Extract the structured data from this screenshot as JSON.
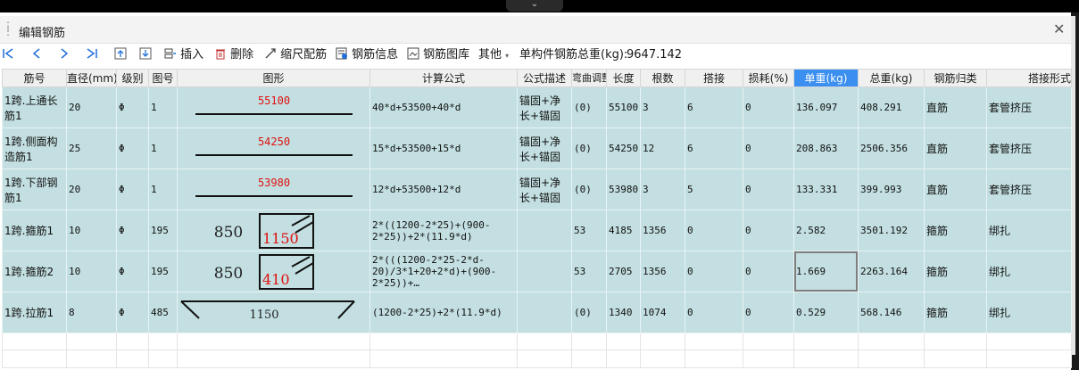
{
  "window": {
    "title": "编辑钢筋"
  },
  "toolbar": {
    "insert": "插入",
    "delete": "删除",
    "scale_rebar": "缩尺配筋",
    "rebar_info": "钢筋信息",
    "rebar_library": "钢筋图库",
    "other": "其他",
    "total_label": "单构件钢筋总重(kg):",
    "total_value": "9647.142"
  },
  "columns": [
    "筋号",
    "直径(mm)",
    "级别",
    "图号",
    "图形",
    "计算公式",
    "公式描述",
    "弯曲调整",
    "长度",
    "根数",
    "搭接",
    "损耗(%)",
    "单重(kg)",
    "总重(kg)",
    "钢筋归类",
    "搭接形式"
  ],
  "rows": [
    {
      "name": "1跨.上通长筋1",
      "dia": "20",
      "grade": "Φ",
      "fig": "1",
      "shape": "line",
      "shape_text": "55100",
      "formula": "40*d+53500+40*d",
      "desc": "锚固+净长+锚固",
      "bend": "(0)",
      "length": "55100",
      "count": "3",
      "lap": "6",
      "loss": "0",
      "unit_weight": "136.097",
      "total_weight": "408.291",
      "category": "直筋",
      "lap_type": "套管挤压"
    },
    {
      "name": "1跨.侧面构造筋1",
      "dia": "25",
      "grade": "Φ",
      "fig": "1",
      "shape": "line",
      "shape_text": "54250",
      "formula": "15*d+53500+15*d",
      "desc": "锚固+净长+锚固",
      "bend": "(0)",
      "length": "54250",
      "count": "12",
      "lap": "6",
      "loss": "0",
      "unit_weight": "208.863",
      "total_weight": "2506.356",
      "category": "直筋",
      "lap_type": "套管挤压"
    },
    {
      "name": "1跨.下部钢筋1",
      "dia": "20",
      "grade": "Φ",
      "fig": "1",
      "shape": "line",
      "shape_text": "53980",
      "formula": "12*d+53500+12*d",
      "desc": "锚固+净长+锚固",
      "bend": "(0)",
      "length": "53980",
      "count": "3",
      "lap": "5",
      "loss": "0",
      "unit_weight": "133.331",
      "total_weight": "399.993",
      "category": "直筋",
      "lap_type": "套管挤压"
    },
    {
      "name": "1跨.箍筋1",
      "dia": "10",
      "grade": "Φ",
      "fig": "195",
      "shape": "stirrup",
      "shape_text": "850",
      "shape_text2": "1150",
      "formula": "2*((1200-2*25)+(900-2*25))+2*(11.9*d)",
      "desc": "",
      "bend": "53",
      "length": "4185",
      "count": "1356",
      "lap": "0",
      "loss": "0",
      "unit_weight": "2.582",
      "total_weight": "3501.192",
      "category": "箍筋",
      "lap_type": "绑扎"
    },
    {
      "name": "1跨.箍筋2",
      "dia": "10",
      "grade": "Φ",
      "fig": "195",
      "shape": "stirrup",
      "shape_text": "850",
      "shape_text2": "410",
      "formula": "2*(((1200-2*25-2*d-20)/3*1+20+2*d)+(900-2*25))+…",
      "desc": "",
      "bend": "53",
      "length": "2705",
      "count": "1356",
      "lap": "0",
      "loss": "0",
      "unit_weight": "1.669",
      "total_weight": "2263.164",
      "category": "箍筋",
      "lap_type": "绑扎"
    },
    {
      "name": "1跨.拉筋1",
      "dia": "8",
      "grade": "Φ",
      "fig": "485",
      "shape": "tie",
      "shape_text": "1150",
      "formula": "(1200-2*25)+2*(11.9*d)",
      "desc": "",
      "bend": "(0)",
      "length": "1340",
      "count": "1074",
      "lap": "0",
      "loss": "0",
      "unit_weight": "0.529",
      "total_weight": "568.146",
      "category": "箍筋",
      "lap_type": "绑扎"
    }
  ],
  "colors": {
    "row_bg": "#c3dfe1",
    "selected_header": "#3a8ff0",
    "icon_blue": "#1e6fd9",
    "dim_red": "#e01010"
  }
}
